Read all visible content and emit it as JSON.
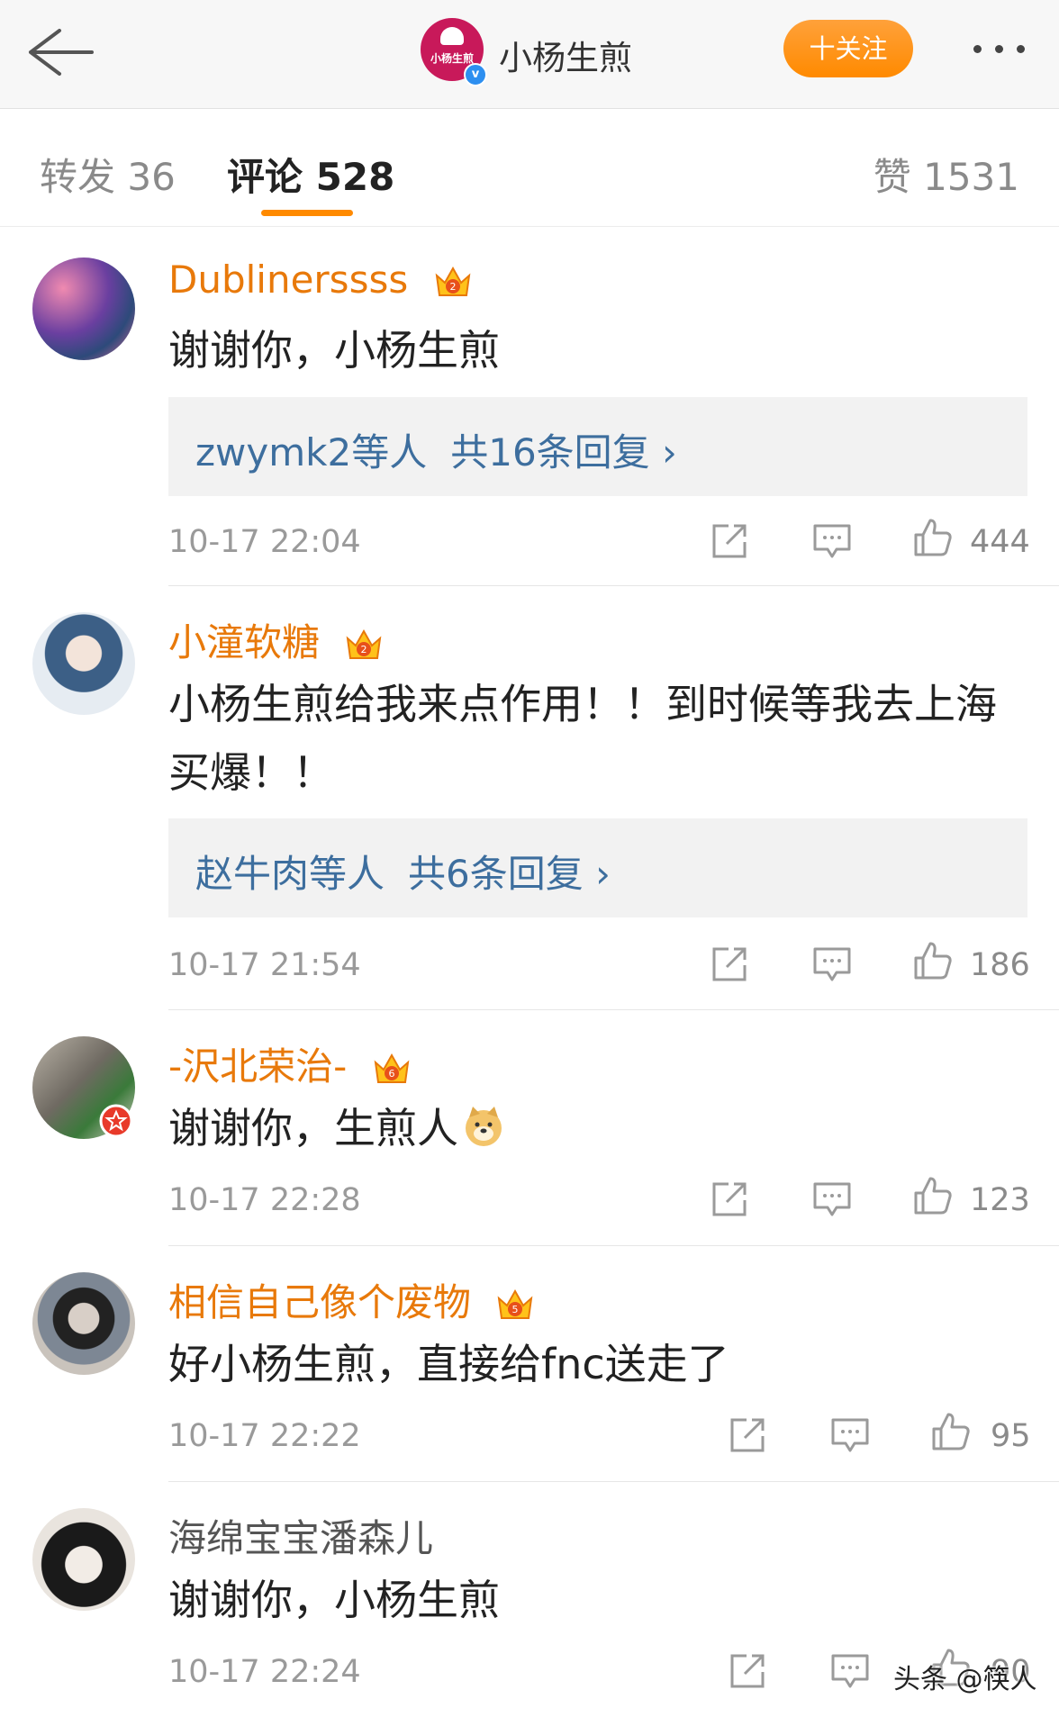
{
  "header": {
    "brand_name": "小杨生煎",
    "brand_logo_text": "小杨生煎",
    "follow_label": "十关注",
    "verified_mark": "v"
  },
  "tabs": {
    "repost": "转发 36",
    "comments": "评论 528",
    "likes": "赞 1531"
  },
  "comments": [
    {
      "user": "Dublinerssss",
      "crown_level": "2",
      "text": "谢谢你，小杨生煎",
      "reply_users": "zwymk2等人",
      "reply_count": "共16条回复 ›",
      "time": "10-17 22:04",
      "likes": "444"
    },
    {
      "user": "小潼软糖",
      "crown_level": "2",
      "text": "小杨生煎给我来点作用！！到时候等我去上海买爆！！",
      "reply_users": "赵牛肉等人",
      "reply_count": "共6条回复 ›",
      "time": "10-17 21:54",
      "likes": "186"
    },
    {
      "user": "-沢北荣治-",
      "crown_level": "6",
      "text": "谢谢你，生煎人",
      "time": "10-17 22:28",
      "likes": "123"
    },
    {
      "user": "相信自己像个废物",
      "crown_level": "5",
      "text": "好小杨生煎，直接给fnc送走了",
      "time": "10-17 22:22",
      "likes": "95"
    },
    {
      "user": "海绵宝宝潘森儿",
      "text": "谢谢你，小杨生煎",
      "time": "10-17 22:24",
      "likes": "90"
    }
  ],
  "watermark": "头条 @筷人",
  "colors": {
    "accent": "#ff8a00",
    "username": "#e8790a",
    "reply_link": "#3d6e9e"
  }
}
